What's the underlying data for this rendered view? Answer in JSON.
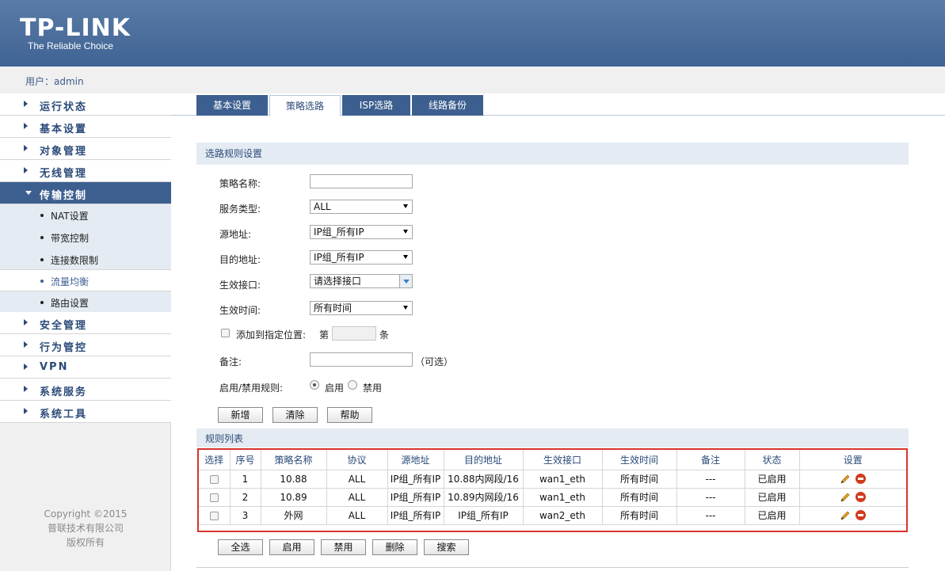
{
  "brand": {
    "logo_text": "TP-LINK",
    "tagline": "The Reliable Choice"
  },
  "user": {
    "label": "用户：admin"
  },
  "sidebar": {
    "items": [
      {
        "label": "运行状态"
      },
      {
        "label": "基本设置"
      },
      {
        "label": "对象管理"
      },
      {
        "label": "无线管理"
      },
      {
        "label": "传输控制"
      },
      {
        "label": "安全管理"
      },
      {
        "label": "行为管控"
      },
      {
        "label": "VPN"
      },
      {
        "label": "系统服务"
      },
      {
        "label": "系统工具"
      }
    ],
    "subitems": [
      {
        "label": "NAT设置"
      },
      {
        "label": "带宽控制"
      },
      {
        "label": "连接数限制"
      },
      {
        "label": "流量均衡"
      },
      {
        "label": "路由设置"
      }
    ],
    "copyright": [
      "Copyright ©2015",
      "普联技术有限公司",
      "版权所有"
    ]
  },
  "tabs": [
    {
      "label": "基本设置"
    },
    {
      "label": "策略选路"
    },
    {
      "label": "ISP选路"
    },
    {
      "label": "线路备份"
    }
  ],
  "form": {
    "section_title": "选路规则设置",
    "policy_name_label": "策略名称:",
    "policy_name_value": "",
    "service_type_label": "服务类型:",
    "service_type_value": "ALL",
    "source_label": "源地址:",
    "source_value": "IP组_所有IP",
    "dest_label": "目的地址:",
    "dest_value": "IP组_所有IP",
    "iface_label": "生效接口:",
    "iface_value": "请选择接口",
    "time_label": "生效时间:",
    "time_value": "所有时间",
    "position_label": "添加到指定位置:",
    "position_prefix": "第",
    "position_suffix": "条",
    "remark_label": "备注:",
    "remark_hint": "（可选）",
    "enable_label": "启用/禁用规则:",
    "enable_on": "启用",
    "enable_off": "禁用",
    "buttons": {
      "add": "新增",
      "clear": "清除",
      "help": "帮助"
    }
  },
  "rules": {
    "section_title": "规则列表",
    "columns": [
      "选择",
      "序号",
      "策略名称",
      "协议",
      "源地址",
      "目的地址",
      "生效接口",
      "生效时间",
      "备注",
      "状态",
      "设置"
    ],
    "rows": [
      {
        "index": "1",
        "name": "10.88",
        "protocol": "ALL",
        "source": "IP组_所有IP",
        "dest": "10.88内网段/16",
        "iface": "wan1_eth",
        "time": "所有时间",
        "remark": "---",
        "status": "已启用"
      },
      {
        "index": "2",
        "name": "10.89",
        "protocol": "ALL",
        "source": "IP组_所有IP",
        "dest": "10.89内网段/16",
        "iface": "wan1_eth",
        "time": "所有时间",
        "remark": "---",
        "status": "已启用"
      },
      {
        "index": "3",
        "name": "外网",
        "protocol": "ALL",
        "source": "IP组_所有IP",
        "dest": "IP组_所有IP",
        "iface": "wan2_eth",
        "time": "所有时间",
        "remark": "---",
        "status": "已启用"
      }
    ],
    "buttons": {
      "select_all": "全选",
      "enable": "启用",
      "disable": "禁用",
      "delete": "删除",
      "search": "搜索"
    }
  },
  "colors": {
    "header": "#3f6394",
    "accent": "#2b4a78",
    "highlight_border": "#d9342b"
  }
}
